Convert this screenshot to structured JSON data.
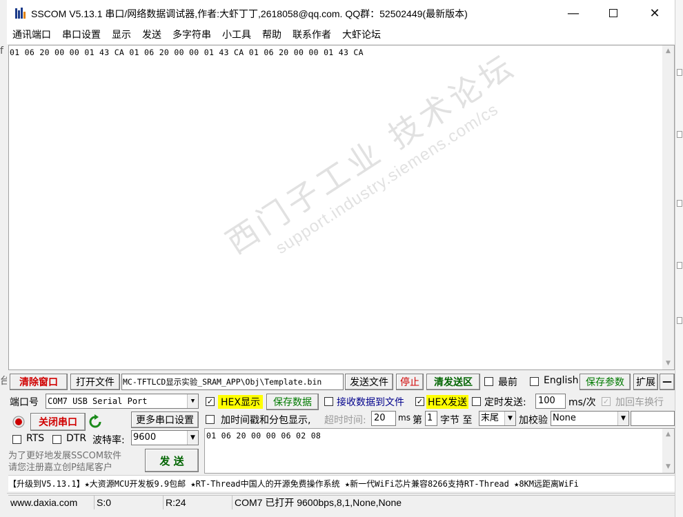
{
  "window": {
    "title": "SSCOM V5.13.1 串口/网络数据调试器,作者:大虾丁丁,2618058@qq.com. QQ群：52502449(最新版本)"
  },
  "menu": [
    "通讯端口",
    "串口设置",
    "显示",
    "发送",
    "多字符串",
    "小工具",
    "帮助",
    "联系作者",
    "大虾论坛"
  ],
  "receive": {
    "text": "01 06 20 00 00 01 43 CA 01 06 20 00 00 01 43 CA 01 06 20 00 00 01 43 CA"
  },
  "watermark": {
    "line1": "西门子工业 技术论坛",
    "line2": "support.industry.siemens.com/cs"
  },
  "toolbar": {
    "clear_window": "清除窗口",
    "open_file": "打开文件",
    "file_path": "MC-TFTLCD显示实验_SRAM_APP\\Obj\\Template.bin",
    "send_file": "发送文件",
    "stop": "停止",
    "clear_send": "清发送区",
    "topmost": "最前",
    "english": "English",
    "save_params": "保存参数",
    "expand": "扩展",
    "collapse": "—"
  },
  "panel": {
    "port_label": "端口号",
    "port_value": "COM7 USB Serial Port",
    "hex_display": "HEX显示",
    "save_data": "保存数据",
    "recv_to_file": "接收数据到文件",
    "hex_send": "HEX发送",
    "timed_send": "定时发送:",
    "timed_value": "100",
    "timed_unit": "ms/次",
    "append_newline": "加回车换行",
    "close_port": "关闭串口",
    "more_settings": "更多串口设置",
    "add_timestamp": "加时间戳和分包显示,",
    "timeout_label": "超时时间:",
    "timeout_value": "20",
    "timeout_unit": "ms",
    "byte_from_label": "第",
    "byte_from_value": "1",
    "byte_label": "字节 至",
    "byte_to_value": "末尾",
    "checksum_label": "加校验",
    "checksum_value": "None",
    "rts": "RTS",
    "dtr": "DTR",
    "baud_label": "波特率:",
    "baud_value": "9600",
    "promo_line1": "为了更好地发展SSCOM软件",
    "promo_line2": "请您注册嘉立创P结尾客户",
    "send_button": "发 送",
    "send_text": "01 06 20 00 00 06 02 08"
  },
  "ticker": "【升级到V5.13.1】★大资源MCU开发板9.9包邮 ★RT-Thread中国人的开源免费操作系统 ★新一代WiFi芯片兼容8266支持RT-Thread ★8KM远距离WiFi",
  "status": {
    "website": "www.daxia.com",
    "sent": "S:0",
    "received": "R:24",
    "port_status": "COM7 已打开  9600bps,8,1,None,None"
  },
  "colors": {
    "red_text": "#d00000",
    "green_text": "#007a00",
    "hex_highlight": "#ffff00",
    "record_red": "#cc0000"
  }
}
